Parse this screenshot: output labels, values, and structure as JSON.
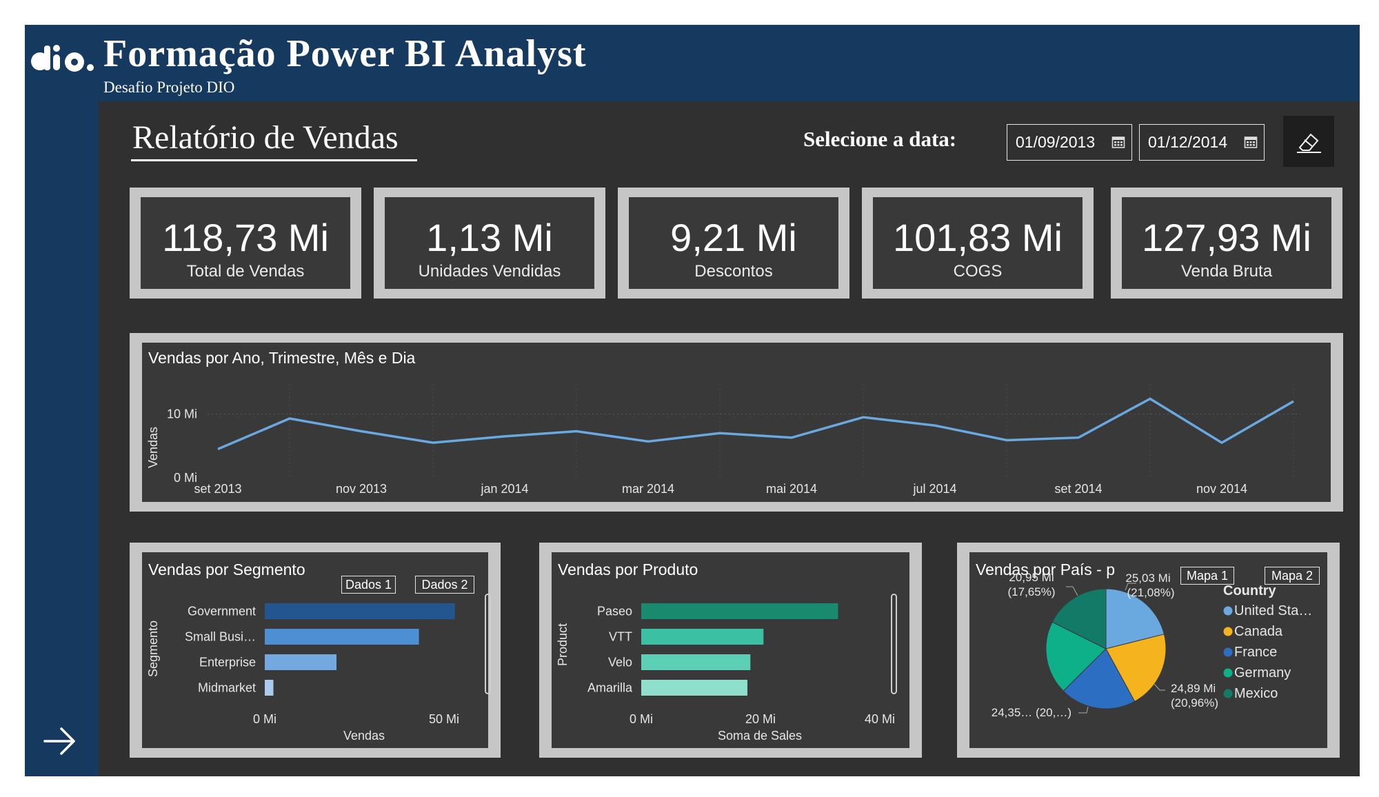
{
  "header": {
    "title": "Formação Power BI Analyst",
    "subtitle": "Desafio Projeto DIO",
    "report_title": "Relatório de Vendas"
  },
  "date_filter": {
    "label": "Selecione a data:",
    "start": "01/09/2013",
    "end": "01/12/2014"
  },
  "kpis": [
    {
      "value": "118,73 Mi",
      "label": "Total de Vendas"
    },
    {
      "value": "1,13 Mi",
      "label": "Unidades Vendidas"
    },
    {
      "value": "9,21 Mi",
      "label": "Descontos"
    },
    {
      "value": "101,83 Mi",
      "label": "COGS"
    },
    {
      "value": "127,93 Mi",
      "label": "Venda Bruta"
    }
  ],
  "line_panel": {
    "title": "Vendas por Ano, Trimestre, Mês e Dia"
  },
  "segment_panel": {
    "title": "Vendas por Segmento",
    "buttons": [
      "Dados 1",
      "Dados 2"
    ]
  },
  "product_panel": {
    "title": "Vendas por Produto"
  },
  "country_panel": {
    "title": "Vendas por País - p",
    "buttons": [
      "Mapa 1",
      "Mapa 2"
    ]
  },
  "colors": {
    "frame": "#163a5f",
    "canvas": "#303030",
    "line": "#6aa8e0",
    "segment_bars": [
      "#23568f",
      "#4d8fd3",
      "#74a9e0",
      "#a9ccf0"
    ],
    "product_bars": [
      "#1a8a6e",
      "#3cc0a3",
      "#5dcfb4",
      "#8edfcb"
    ],
    "pie": [
      "#6aa8e0",
      "#f5b41d",
      "#2b6ec2",
      "#0eb08a",
      "#127a66"
    ]
  },
  "chart_data": [
    {
      "type": "line",
      "title": "Vendas por Ano, Trimestre, Mês e Dia",
      "ylabel": "Vendas",
      "ylim": [
        0,
        10.6
      ],
      "y_ticks": [
        "0 Mi",
        "10 Mi"
      ],
      "x_ticks": [
        "set 2013",
        "nov 2013",
        "jan 2014",
        "mar 2014",
        "mai 2014",
        "jul 2014",
        "set 2014",
        "nov 2014"
      ],
      "x": [
        "2013-09",
        "2013-10",
        "2013-11",
        "2013-12",
        "2014-01",
        "2014-02",
        "2014-03",
        "2014-04",
        "2014-05",
        "2014-06",
        "2014-07",
        "2014-08",
        "2014-09",
        "2014-10",
        "2014-11",
        "2014-12"
      ],
      "series": [
        {
          "values": [
            4.5,
            9.3,
            7.3,
            5.5,
            6.5,
            7.3,
            5.7,
            7.0,
            6.3,
            9.5,
            8.2,
            5.9,
            6.3,
            12.4,
            5.5,
            12.0
          ]
        }
      ]
    },
    {
      "type": "bar",
      "title": "Vendas por Segmento",
      "orientation": "horizontal",
      "categories": [
        "Government",
        "Small Busi…",
        "Enterprise",
        "Midmarket"
      ],
      "values": [
        53.0,
        43.0,
        20.0,
        2.4
      ],
      "xlabel": "Vendas",
      "ylabel": "Segmento",
      "x_ticks": [
        "0 Mi",
        "50 Mi"
      ],
      "xlim": [
        0,
        60
      ]
    },
    {
      "type": "bar",
      "title": "Vendas por Produto",
      "orientation": "horizontal",
      "categories": [
        "Paseo",
        "VTT",
        "Velo",
        "Amarilla"
      ],
      "values": [
        33.0,
        20.5,
        18.3,
        17.8
      ],
      "xlabel": "Soma de Sales",
      "ylabel": "Product",
      "x_ticks": [
        "0 Mi",
        "20 Mi",
        "40 Mi"
      ],
      "xlim": [
        0,
        40
      ]
    },
    {
      "type": "pie",
      "title": "Vendas por País - p",
      "legend_title": "Country",
      "legend_position": "right",
      "categories": [
        "United Sta…",
        "Canada",
        "France",
        "Germany",
        "Mexico"
      ],
      "values": [
        25.03,
        24.89,
        24.35,
        23.5,
        20.95
      ],
      "data_labels": [
        {
          "value": "25,03 Mi",
          "pct": "(21,08%)"
        },
        {
          "value": "24,89 Mi",
          "pct": "(20,96%)"
        },
        {
          "value": "24,35…",
          "pct": "(20,…)"
        },
        {
          "value": "20,95 Mi",
          "pct": "(17,65%)"
        }
      ]
    }
  ]
}
